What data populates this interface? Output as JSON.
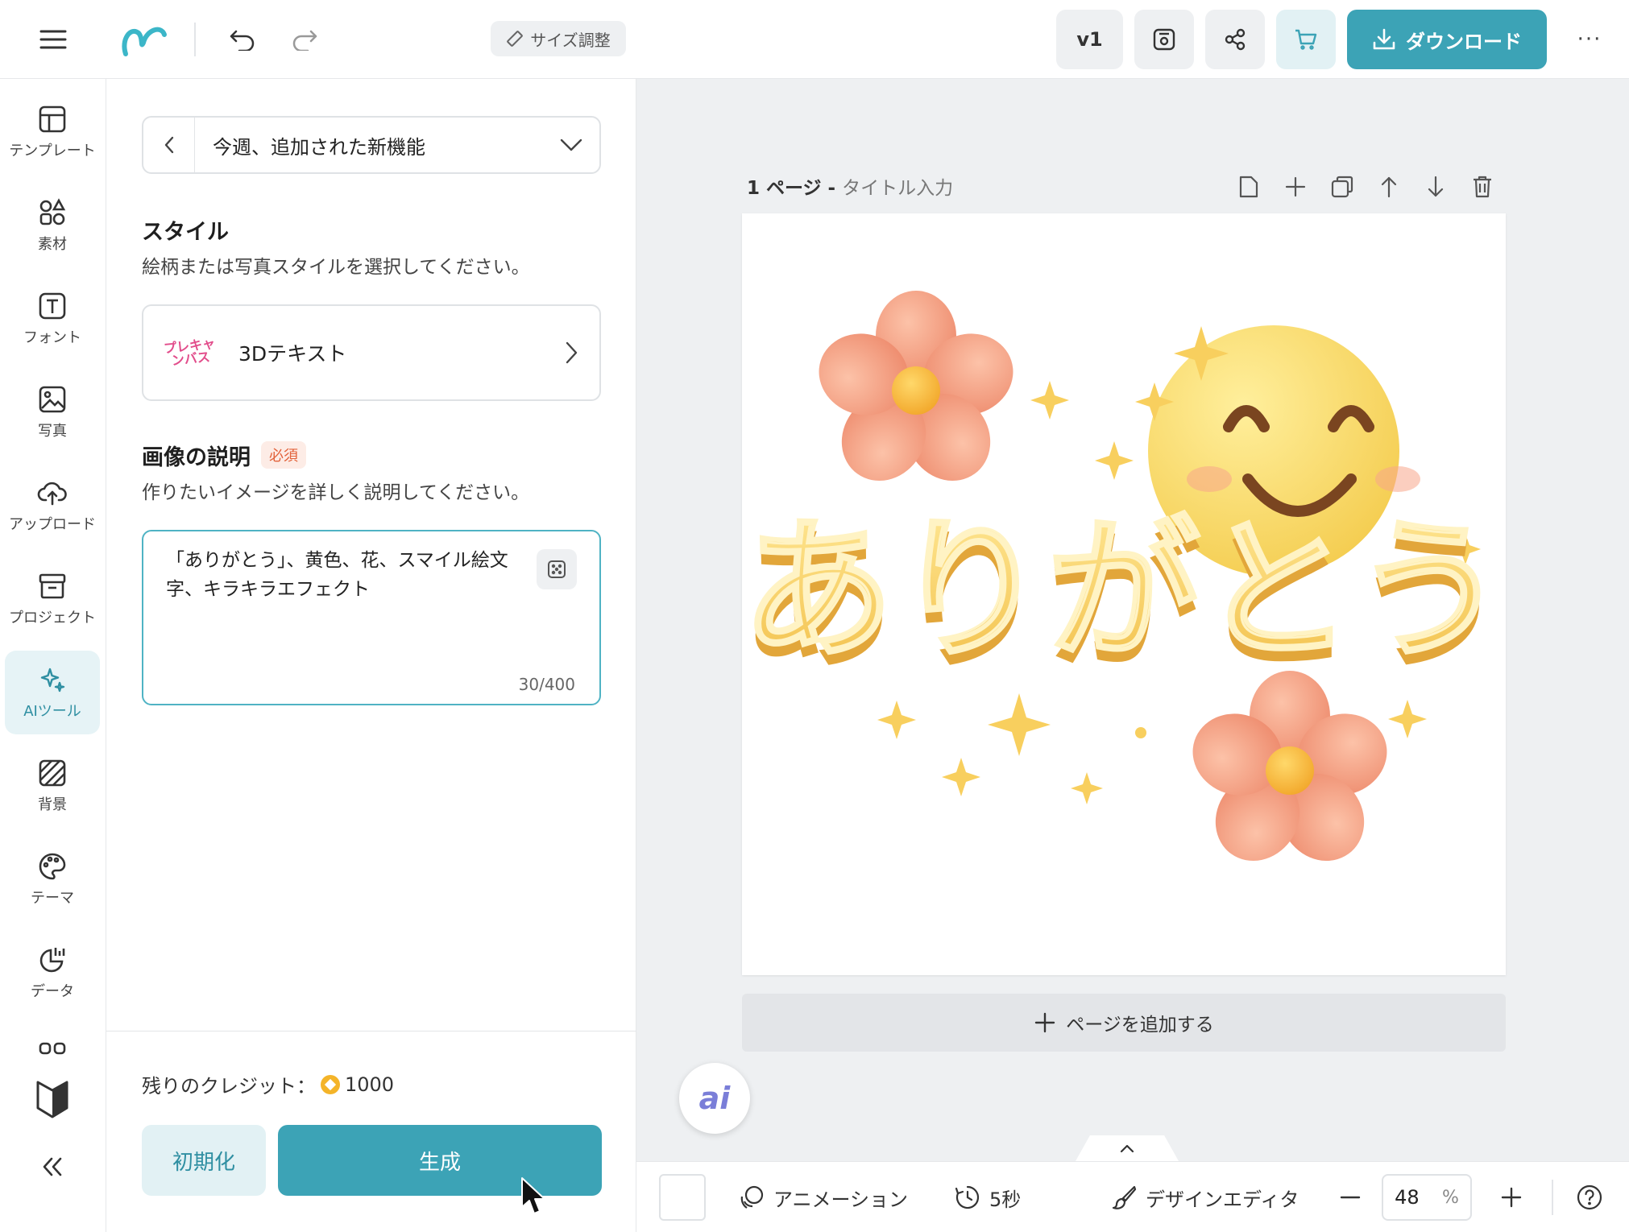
{
  "topbar": {
    "resize_label": "サイズ調整",
    "version_label": "v1",
    "download_label": "ダウンロード",
    "more_label": "···"
  },
  "rail": {
    "items": [
      {
        "label": "テンプレート",
        "icon": "template-icon"
      },
      {
        "label": "素材",
        "icon": "elements-icon"
      },
      {
        "label": "フォント",
        "icon": "font-icon"
      },
      {
        "label": "写真",
        "icon": "photo-icon"
      },
      {
        "label": "アップロード",
        "icon": "upload-icon"
      },
      {
        "label": "プロジェクト",
        "icon": "project-icon"
      },
      {
        "label": "AIツール",
        "icon": "ai-sparkle-icon"
      },
      {
        "label": "背景",
        "icon": "background-icon"
      },
      {
        "label": "テーマ",
        "icon": "palette-icon"
      },
      {
        "label": "データ",
        "icon": "chart-icon"
      }
    ],
    "active": "AIツール"
  },
  "panel": {
    "dropdown_title": "今週、追加された新機能",
    "style_title": "スタイル",
    "style_desc": "絵柄または写真スタイルを選択してください。",
    "style_thumb_text": "プレキャンバス",
    "style_name": "3Dテキスト",
    "desc_title": "画像の説明",
    "required_badge": "必須",
    "desc_help": "作りたいイメージを詳しく説明してください。",
    "prompt_value": "「ありがとう」、黄色、花、スマイル絵文字、キラキラエフェクト",
    "char_count": "30/400",
    "credits_label": "残りのクレジット：",
    "credits_value": "1000",
    "reset_label": "初期化",
    "generate_label": "生成"
  },
  "canvas": {
    "page_number": "1 ページ - ",
    "page_title_placeholder": "タイトル入力",
    "add_page_label": "ページを追加する",
    "ai_button": "ai",
    "artwork_text": "ありがとう"
  },
  "bottombar": {
    "animation_label": "アニメーション",
    "duration_label": "5秒",
    "design_editor_label": "デザインエディタ",
    "zoom_value": "48",
    "zoom_unit": "%"
  },
  "colors": {
    "accent": "#3ca3b6",
    "accent_light": "#e2f1f4",
    "required": "#e2623a"
  }
}
